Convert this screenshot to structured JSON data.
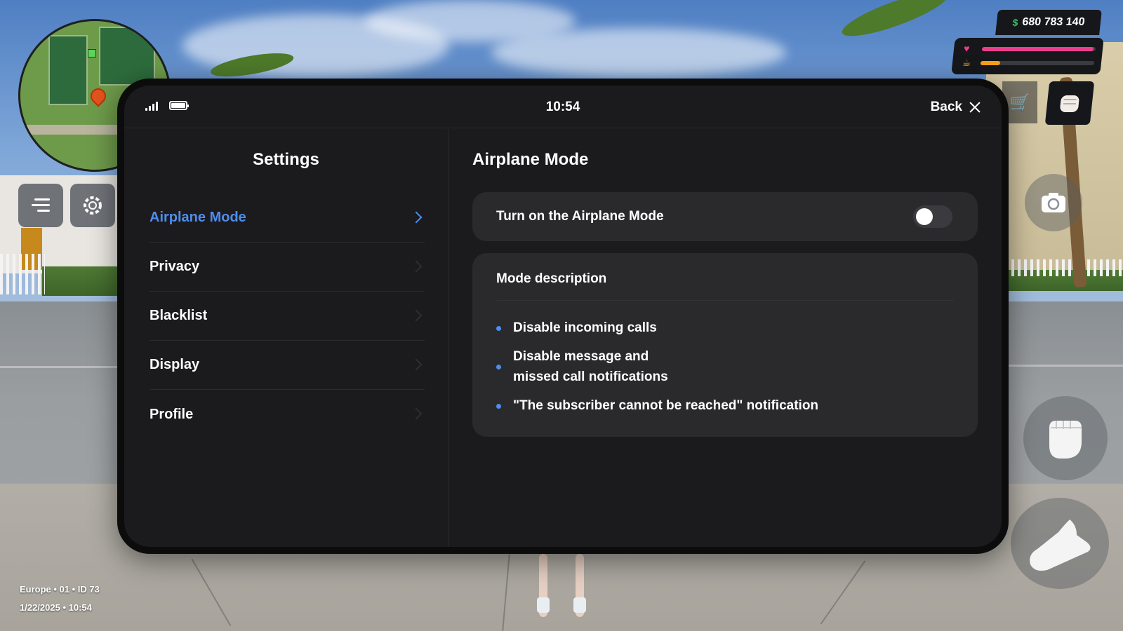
{
  "hud": {
    "money": "680 783 140",
    "money_symbol": "$",
    "health_fraction": 0.98,
    "hunger_fraction": 0.17,
    "colors": {
      "health": "#ec3d8c",
      "hunger": "#f4a018",
      "money_symbol": "#39c46a"
    }
  },
  "server": {
    "line1": "Europe • 01 • ID 73",
    "line2": "1/22/2025 • 10:54"
  },
  "phone": {
    "clock": "10:54",
    "back_label": "Back",
    "settings_title": "Settings",
    "nav": [
      {
        "label": "Airplane Mode",
        "active": true
      },
      {
        "label": "Privacy",
        "active": false
      },
      {
        "label": "Blacklist",
        "active": false
      },
      {
        "label": "Display",
        "active": false
      },
      {
        "label": "Profile",
        "active": false
      }
    ],
    "content": {
      "title": "Airplane Mode",
      "toggle_label": "Turn on the Airplane Mode",
      "toggle_on": false,
      "description_title": "Mode description",
      "description_items": [
        "Disable incoming calls",
        "Disable message and\nmissed call notifications",
        "\"The subscriber cannot be reached\" notification"
      ]
    },
    "accent_color": "#4d8df0"
  }
}
